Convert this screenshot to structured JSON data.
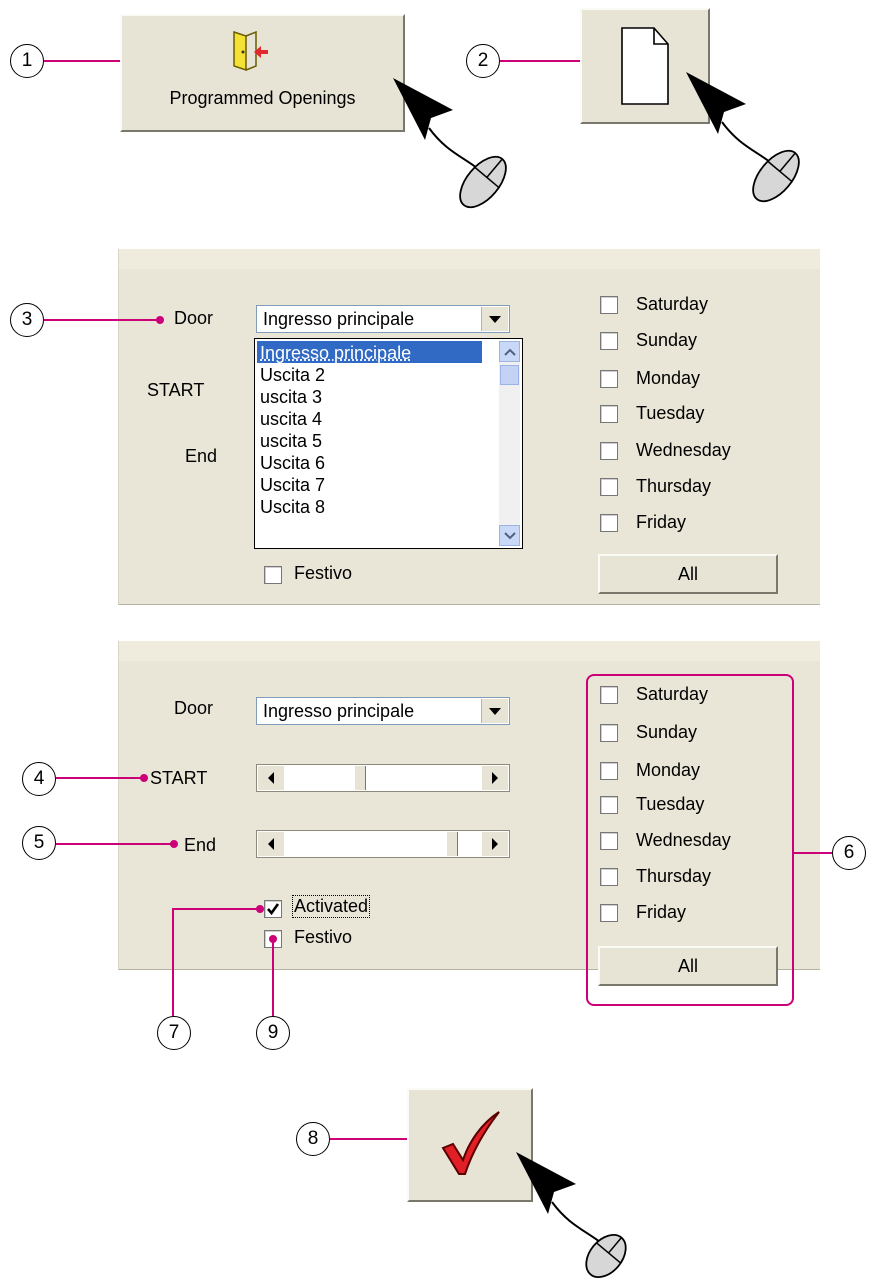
{
  "callouts": [
    "1",
    "2",
    "3",
    "4",
    "5",
    "6",
    "7",
    "8",
    "9"
  ],
  "top_buttons": {
    "programmed_openings_label": "Programmed Openings",
    "door_icon": "door-exit-icon",
    "new_icon": "new-document-icon"
  },
  "panel1": {
    "door_label": "Door",
    "start_label": "START",
    "end_label": "End",
    "door_value": "Ingresso principale",
    "door_options": [
      "Ingresso principale",
      "Uscita 2",
      "uscita 3",
      "uscita 4",
      "uscita 5",
      "Uscita 6",
      "Uscita 7",
      "Uscita 8"
    ],
    "festivo_label": "Festivo",
    "days": [
      "Saturday",
      "Sunday",
      "Monday",
      "Tuesday",
      "Wednesday",
      "Thursday",
      "Friday"
    ],
    "all_label": "All"
  },
  "panel2": {
    "door_label": "Door",
    "start_label": "START",
    "end_label": "End",
    "door_value": "Ingresso principale",
    "start_slider_fraction": 0.37,
    "end_slider_fraction": 0.86,
    "activated_label": "Activated",
    "activated_checked": true,
    "festivo_label": "Festivo",
    "days": [
      "Saturday",
      "Sunday",
      "Monday",
      "Tuesday",
      "Wednesday",
      "Thursday",
      "Friday"
    ],
    "all_label": "All"
  },
  "confirm_icon": "red-checkmark-icon",
  "cursor_icon": "mouse-cursor-icon",
  "colors": {
    "accent": "#cc0077",
    "panel": "#e9e6d8",
    "selection": "#316ac5"
  }
}
